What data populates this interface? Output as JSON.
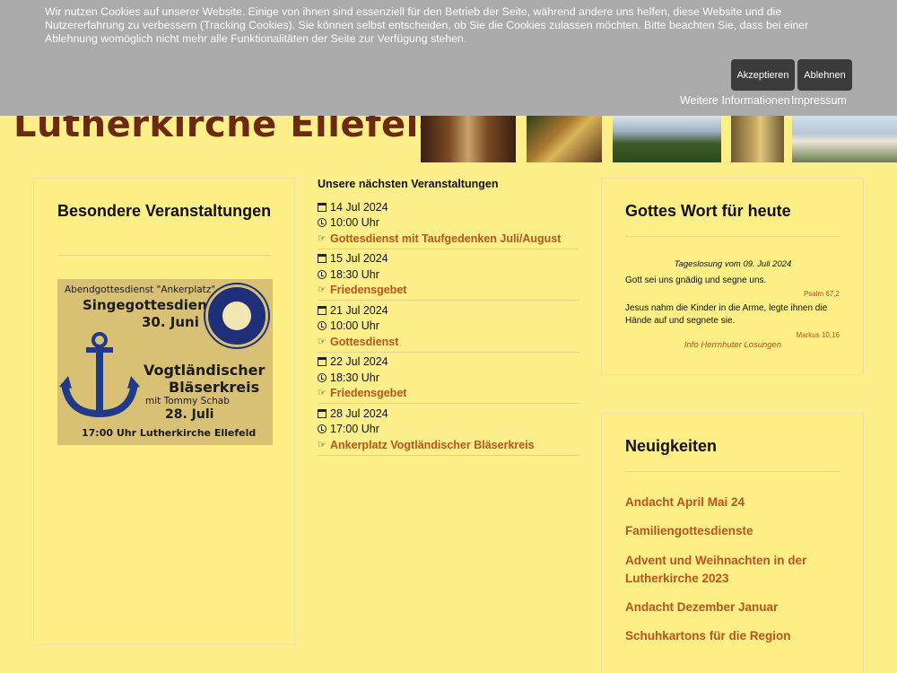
{
  "site": {
    "title": "Lutherkirche Ellefeld"
  },
  "cookie": {
    "text": "Wir nutzen Cookies auf unserer Website. Einige von ihnen sind essenziell für den Betrieb der Seite, während andere uns helfen, diese Website und die Nutzererfahrung zu verbessern (Tracking Cookies). Sie können selbst entscheiden, ob Sie die Cookies zulassen möchten. Bitte beachten Sie, dass bei einer Ablehnung womöglich nicht mehr alle Funktionalitäten der Seite zur Verfügung stehen.",
    "accept_label": "Akzeptieren",
    "reject_label": "Ablehnen",
    "more_info_label": "Weitere Informationen",
    "imprint_label": "Impressum"
  },
  "special": {
    "title": "Besondere Veranstaltungen",
    "poster": {
      "line1": "Abendgottesdienst \"Ankerplatz\"",
      "line2": "Singegottesdienst",
      "line3": "30. Juni",
      "line4": "Vogtländischer",
      "line5": "Bläserkreis",
      "line6": "mit Tommy Schab",
      "line7": "28. Juli",
      "line8": "17:00 Uhr Lutherkirche Ellefeld",
      "seal_text": "ABENDGOTTESDIENST ANKERPLATZ"
    }
  },
  "events": {
    "title": "Unsere nächsten Veranstaltungen",
    "items": [
      {
        "date": "14 Jul 2024",
        "time": "10:00 Uhr",
        "name": "Gottesdienst mit Taufgedenken Juli/August"
      },
      {
        "date": "15 Jul 2024",
        "time": "18:30 Uhr",
        "name": "Friedensgebet"
      },
      {
        "date": "21 Jul 2024",
        "time": "10:00 Uhr",
        "name": "Gottesdienst"
      },
      {
        "date": "22 Jul 2024",
        "time": "18:30 Uhr",
        "name": "Friedensgebet"
      },
      {
        "date": "28 Jul 2024",
        "time": "17:00 Uhr",
        "name": "Ankerplatz Vogtländischer Bläserkreis"
      }
    ]
  },
  "losung": {
    "title": "Gottes Wort für heute",
    "date_line": "Tageslosung vom 09. Juli 2024",
    "text1": "Gott sei uns gnädig und segne uns.",
    "ref1": "Psalm 67,2",
    "text2": "Jesus nahm die Kinder in die Arme, legte ihnen die Hände auf und segnete sie.",
    "ref2": "Markus 10,16",
    "info_link": "Info Herrnhuter Losungen"
  },
  "news": {
    "title": "Neuigkeiten",
    "items": [
      "Andacht April Mai 24",
      "Familiengottesdienste",
      "Advent und Weihnachten in der Lutherkirche 2023",
      "Andacht Dezember Januar",
      "Schuhkartons für die Region"
    ]
  },
  "colors": {
    "background": "#fcee88",
    "link": "#b8551f",
    "title": "#6b2a12",
    "overlay": "#aaaaaa",
    "button": "#3b3b3b"
  }
}
